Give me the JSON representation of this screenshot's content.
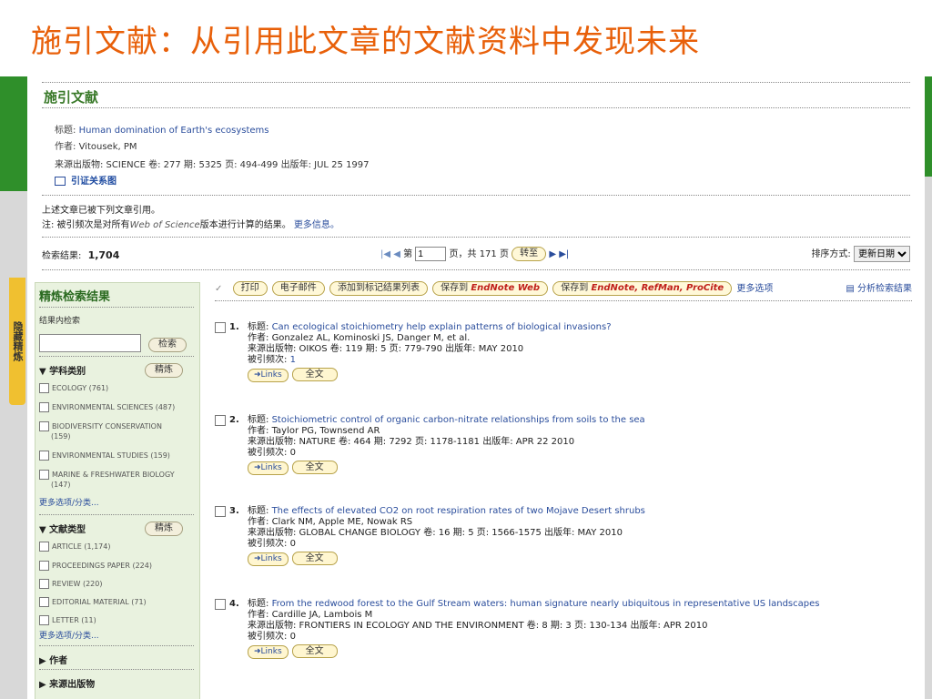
{
  "slide_title": "施引文献：从引用此文章的文献资料中发现未来",
  "section_title": "施引文献",
  "article": {
    "title_label": "标题:",
    "title": "Human domination of Earth's ecosystems",
    "author_label": "作者:",
    "author": "Vitousek, PM",
    "source_line": "来源出版物: SCIENCE 卷: 277 期: 5325 页: 494-499 出版年: JUL 25 1997",
    "citation_map": "引证关系图"
  },
  "notice": {
    "line1": "上述文章已被下列文章引用。",
    "line2_prefix": "注: 被引频次是对所有",
    "line2_wos": "Web of Science",
    "line2_suffix": "版本进行计算的结果。",
    "more_info": "更多信息。"
  },
  "results": {
    "label": "检索结果:",
    "count": "1,704",
    "page_prefix": "第",
    "page_value": "1",
    "page_suffix": "页，共 171 页",
    "go_label": "转至",
    "sort_label": "排序方式:",
    "sort_value": "更新日期"
  },
  "side_tab_label": "隐藏精炼",
  "sidebar": {
    "title": "精炼检索结果",
    "search_within": "结果内检索",
    "search_btn": "检索",
    "refine_btn": "精炼",
    "facet1": "学科类别",
    "facet1_items": [
      "ECOLOGY (761)",
      "ENVIRONMENTAL SCIENCES (487)",
      "BIODIVERSITY CONSERVATION",
      "(159)",
      "ENVIRONMENTAL STUDIES (159)",
      "MARINE & FRESHWATER BIOLOGY",
      "(147)"
    ],
    "more_options": "更多选项/分类...",
    "facet2": "文献类型",
    "facet2_items": [
      "ARTICLE (1,174)",
      "PROCEEDINGS PAPER (224)",
      "REVIEW (220)",
      "EDITORIAL MATERIAL (71)",
      "LETTER (11)"
    ],
    "facet3": "作者",
    "facet4": "来源出版物"
  },
  "toolbar": {
    "print": "打印",
    "email": "电子邮件",
    "add_marked": "添加到标记结果列表",
    "save_to": "保存到",
    "endnote_web": "EndNote Web",
    "save_to2": "保存到",
    "endnote_ref": "EndNote, RefMan, ProCite",
    "more_options": "更多选项",
    "analyze": "分析检索结果"
  },
  "record_labels": {
    "title": "标题:",
    "author": "作者:",
    "cited": "被引频次:",
    "links": "Links",
    "fulltext": "全文"
  },
  "records": [
    {
      "num": "1.",
      "title": "Can ecological stoichiometry help explain patterns of biological invasions?",
      "author": "Gonzalez AL, Kominoski JS, Danger M, et al.",
      "source": "来源出版物: OIKOS  卷: 119  期: 5  页: 779-790  出版年: MAY 2010",
      "cited": "1"
    },
    {
      "num": "2.",
      "title": "Stoichiometric control of organic carbon-nitrate relationships from soils to the sea",
      "author": "Taylor PG, Townsend AR",
      "source": "来源出版物: NATURE  卷: 464  期: 7292  页: 1178-1181  出版年: APR 22 2010",
      "cited": "0"
    },
    {
      "num": "3.",
      "title": "The effects of elevated CO2 on root respiration rates of two Mojave Desert shrubs",
      "author": "Clark NM, Apple ME, Nowak RS",
      "source": "来源出版物: GLOBAL CHANGE BIOLOGY  卷: 16  期: 5  页: 1566-1575  出版年: MAY 2010",
      "cited": "0"
    },
    {
      "num": "4.",
      "title": "From the redwood forest to the Gulf Stream waters: human signature nearly ubiquitous in representative US landscapes",
      "author": "Cardille JA, Lambois M",
      "source": "来源出版物: FRONTIERS IN ECOLOGY AND THE ENVIRONMENT  卷: 8  期: 3  页: 130-134  出版年: APR 2010",
      "cited": "0"
    }
  ]
}
